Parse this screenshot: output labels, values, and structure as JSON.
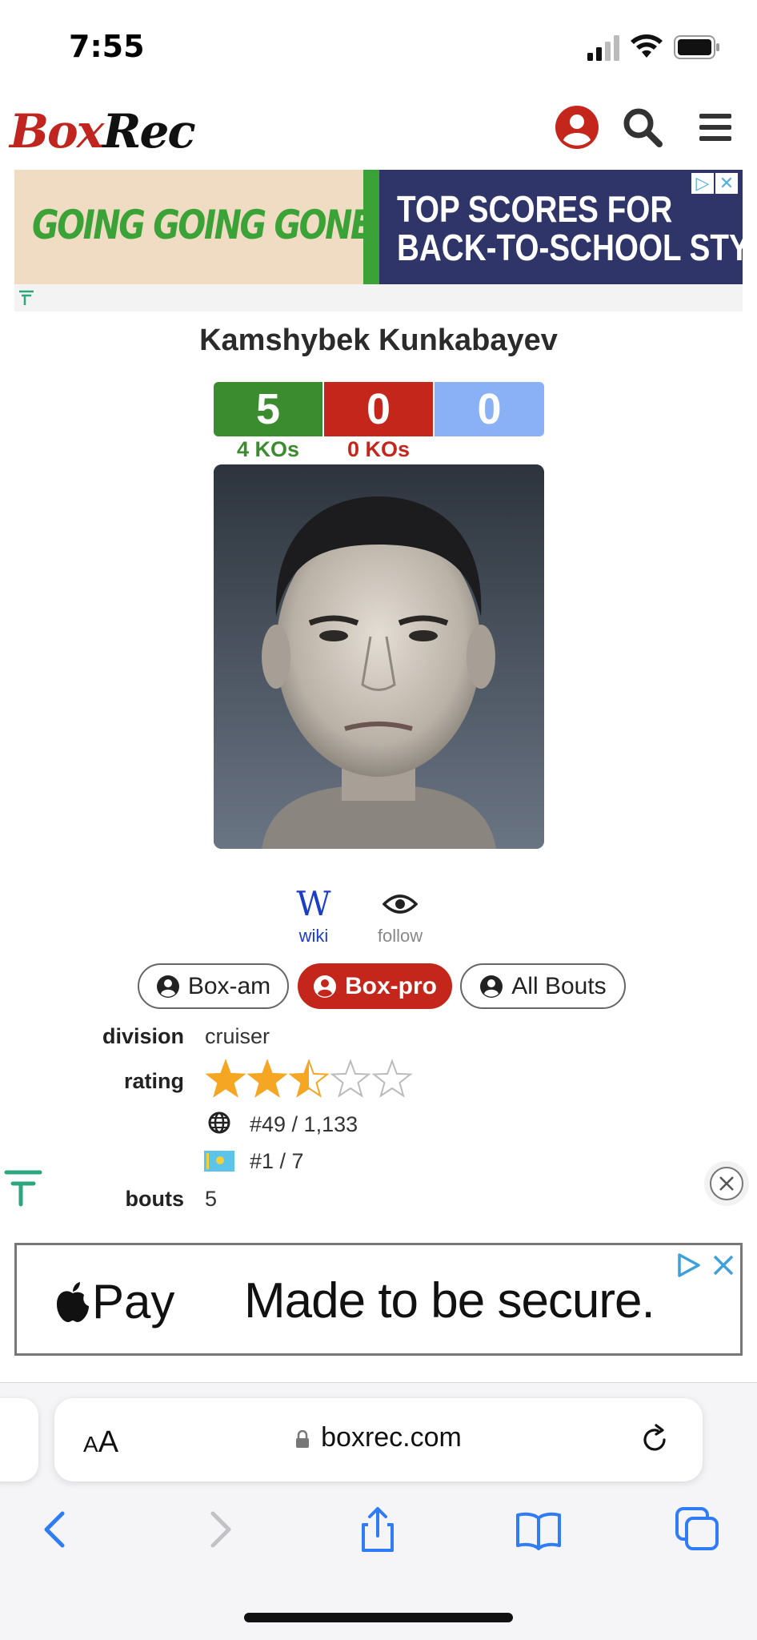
{
  "status_bar": {
    "time": "7:55"
  },
  "site": {
    "logo_part1": "Box",
    "logo_part2": "Rec"
  },
  "ad_top": {
    "left_text": "GOING GOING GONE!",
    "right_line1": "TOP SCORES FOR",
    "right_line2": "BACK-TO-SCHOOL STYLE"
  },
  "boxer": {
    "name": "Kamshybek Kunkabayev",
    "record": {
      "wins": "5",
      "losses": "0",
      "draws": "0"
    },
    "ko_wins": "4 KOs",
    "ko_losses": "0 KOs"
  },
  "links": {
    "wiki_glyph": "W",
    "wiki": "wiki",
    "follow": "follow"
  },
  "tabs": [
    {
      "label": "Box-am",
      "active": false
    },
    {
      "label": "Box-pro",
      "active": true
    },
    {
      "label": "All Bouts",
      "active": false
    }
  ],
  "stats": {
    "division_label": "division",
    "division": "cruiser",
    "rating_label": "rating",
    "rating_stars": 2.5,
    "rating_max": 5,
    "world_rank": "#49 / 1,133",
    "country_rank": "#1 / 7",
    "bouts_label": "bouts",
    "bouts": "5"
  },
  "ad_bottom": {
    "brand": "Pay",
    "message": "Made to be secure."
  },
  "browser": {
    "aa_small": "A",
    "aa_large": "A",
    "url": "boxrec.com"
  },
  "colors": {
    "brand_red": "#c4261c",
    "win_green": "#3b8c2e",
    "draw_blue": "#8ab1f5",
    "star": "#f5a623",
    "ios_blue": "#2f7cf6"
  },
  "icons": {
    "header": [
      "user-circle-icon",
      "search-icon",
      "menu-icon"
    ],
    "toolbar": [
      "back-icon",
      "forward-icon",
      "share-icon",
      "bookmarks-icon",
      "tabs-icon"
    ]
  }
}
